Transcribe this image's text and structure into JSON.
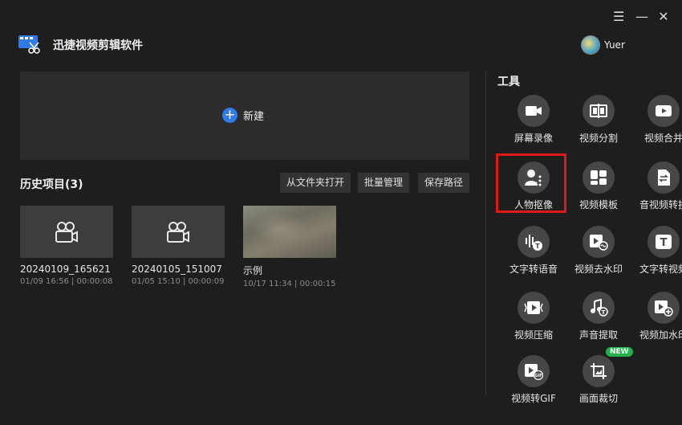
{
  "window": {
    "menu": "☰",
    "minimize": "—",
    "close": "✕"
  },
  "app": {
    "title": "迅捷视频剪辑软件"
  },
  "user": {
    "name": "Yuer"
  },
  "new_project": {
    "label": "新建"
  },
  "history": {
    "title": "历史项目(3)",
    "buttons": [
      "从文件夹打开",
      "批量管理",
      "保存路径"
    ],
    "items": [
      {
        "name": "20240109_165621",
        "meta": "01/09 16:56 | 00:00:08"
      },
      {
        "name": "20240105_151007",
        "meta": "01/05 15:10 | 00:00:09"
      },
      {
        "name": "示例",
        "meta": "10/17 11:34 | 00:00:15"
      }
    ]
  },
  "tools": {
    "title": "工具",
    "badge": "NEW",
    "items": [
      {
        "label": "屏幕录像",
        "icon": "screen-record-icon"
      },
      {
        "label": "视频分割",
        "icon": "video-split-icon"
      },
      {
        "label": "视频合并",
        "icon": "video-merge-icon"
      },
      {
        "label": "人物抠像",
        "icon": "portrait-cutout-icon",
        "selected": true
      },
      {
        "label": "视频模板",
        "icon": "video-template-icon"
      },
      {
        "label": "音视频转换",
        "icon": "convert-icon"
      },
      {
        "label": "文字转语音",
        "icon": "text-to-speech-icon"
      },
      {
        "label": "视频去水印",
        "icon": "remove-watermark-icon"
      },
      {
        "label": "文字转视频",
        "icon": "text-to-video-icon"
      },
      {
        "label": "视频压缩",
        "icon": "video-compress-icon"
      },
      {
        "label": "声音提取",
        "icon": "audio-extract-icon"
      },
      {
        "label": "视频加水印",
        "icon": "add-watermark-icon"
      },
      {
        "label": "视频转GIF",
        "icon": "video-to-gif-icon"
      },
      {
        "label": "画面裁切",
        "icon": "crop-icon",
        "is_new": true
      }
    ]
  },
  "colors": {
    "accent": "#2f7bea",
    "selection": "#e01818",
    "new_badge": "#22b14c"
  }
}
